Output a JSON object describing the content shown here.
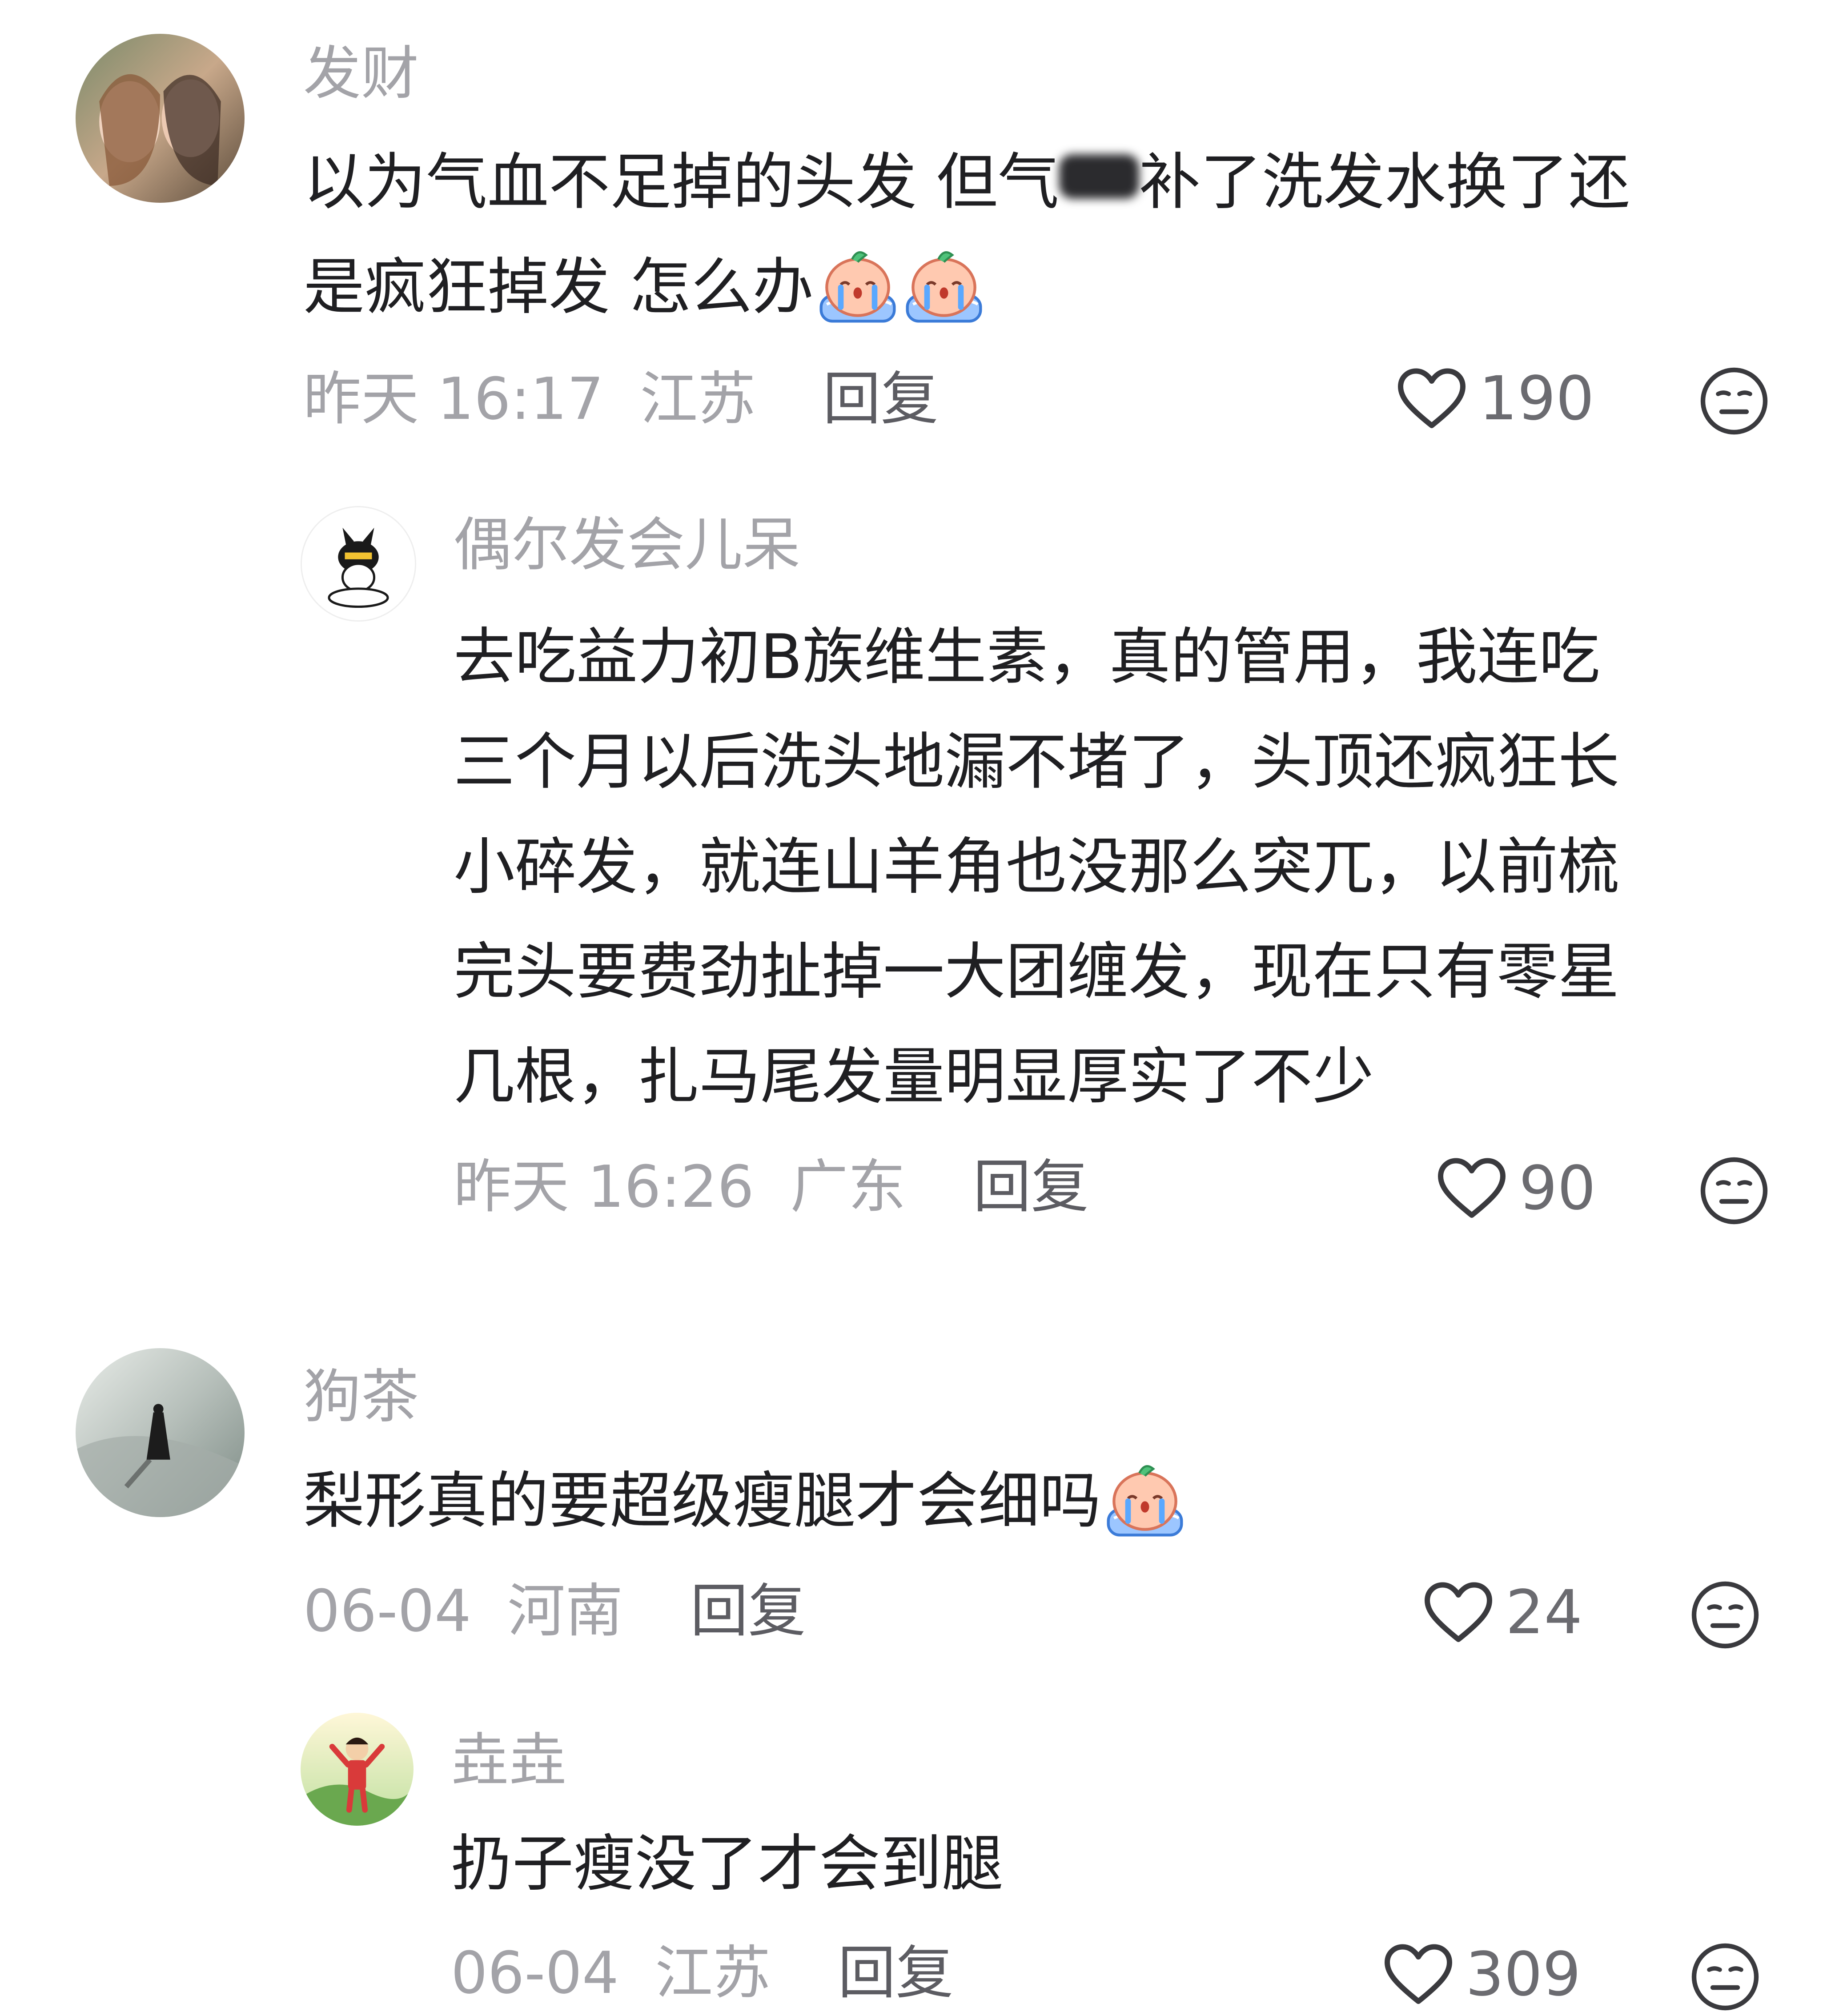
{
  "comments": [
    {
      "name": "发财",
      "text_a": "以为气血不足掉的头发 但气",
      "text_b": "补了洗发水换了还",
      "text_c": "是疯狂掉发 怎么办",
      "time": "昨天 16:17",
      "location": "江苏",
      "reply": "回复",
      "likes": "190"
    },
    {
      "name": "偶尔发会儿呆",
      "text": "去吃益力初B族维生素，真的管用，我连吃\n三个月以后洗头地漏不堵了，头顶还疯狂长\n小碎发，就连山羊角也没那么突兀，以前梳\n完头要费劲扯掉一大团缠发，现在只有零星\n几根，扎马尾发量明显厚实了不少",
      "time": "昨天 16:26",
      "location": "广东",
      "reply": "回复",
      "likes": "90"
    },
    {
      "name": "狗茶",
      "text": "梨形真的要超级瘦腿才会细吗",
      "time": "06-04",
      "location": "河南",
      "reply": "回复",
      "likes": "24"
    },
    {
      "name": "垚垚",
      "text": "扔子瘦没了才会到腿",
      "time": "06-04",
      "location": "江苏",
      "reply": "回复",
      "likes": "309"
    }
  ],
  "icons": {
    "like": "heart-outline-icon",
    "dislike": "neutral-face-icon",
    "emoji": "crying-sticker-emoji"
  },
  "colors": {
    "name": "#a3a3a8",
    "text": "#1f1f22",
    "meta": "#a3a3a8",
    "reply": "#5c5c62"
  }
}
